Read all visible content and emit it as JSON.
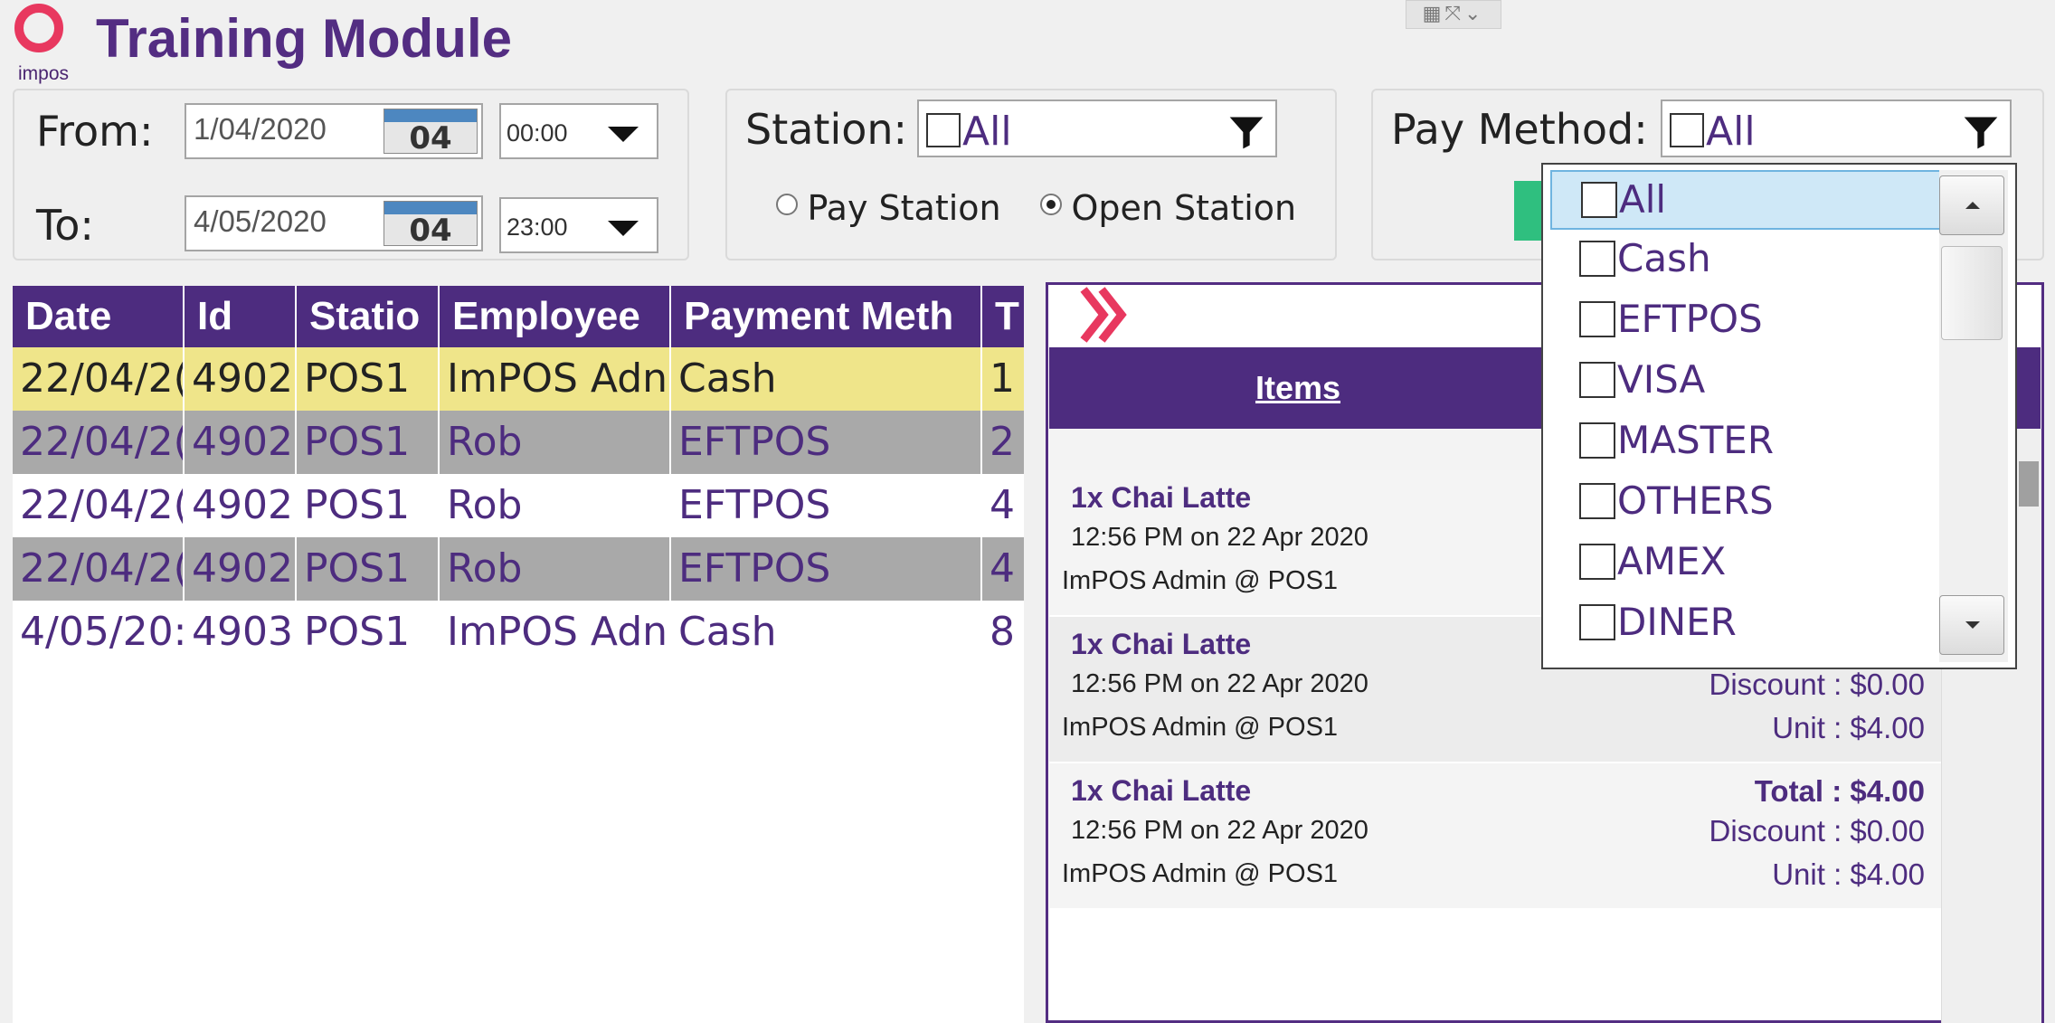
{
  "header": {
    "logo_text": "impos",
    "title": "Training Module"
  },
  "date_filter": {
    "from_label": "From:",
    "from_date": "1/04/2020",
    "from_cal_day": "04",
    "from_time": "00:00",
    "to_label": "To:",
    "to_date": "4/05/2020",
    "to_cal_day": "04",
    "to_time": "23:00"
  },
  "station_filter": {
    "label": "Station:",
    "value": "All",
    "radio_pay": "Pay Station",
    "radio_open": "Open Station",
    "selected": "Open Station"
  },
  "pay_filter": {
    "label": "Pay Method:",
    "value": "All",
    "options": [
      "All",
      "Cash",
      "EFTPOS",
      "VISA",
      "MASTER",
      "OTHERS",
      "AMEX",
      "DINER"
    ],
    "highlighted": "All"
  },
  "grid": {
    "headers": [
      "Date",
      "Id",
      "Statio",
      "Employee",
      "Payment Meth",
      "T"
    ],
    "rows": [
      [
        "22/04/2(",
        "4902!",
        "POS1",
        "ImPOS Adn",
        "Cash",
        "1"
      ],
      [
        "22/04/2(",
        "4902!",
        "POS1",
        "Rob",
        "EFTPOS",
        "2"
      ],
      [
        "22/04/2(",
        "4902!",
        "POS1",
        "Rob",
        "EFTPOS",
        "4"
      ],
      [
        "22/04/2(",
        "4902!",
        "POS1",
        "Rob",
        "EFTPOS",
        "4"
      ],
      [
        "4/05/20:",
        "4903(",
        "POS1",
        "ImPOS Adn",
        "Cash",
        "8"
      ]
    ],
    "row_colors": [
      "#efe58a",
      "#a9a9a9",
      "#ffffff",
      "#a9a9a9",
      "#ffffff"
    ]
  },
  "detail": {
    "items_title": "Items",
    "cards": [
      {
        "name": "1x Chai Latte",
        "time": "12:56 PM on 22 Apr 2020",
        "who": "ImPOS Admin @ POS1",
        "total": "",
        "discount": "",
        "unit": ""
      },
      {
        "name": "1x Chai Latte",
        "time": "12:56 PM on 22 Apr 2020",
        "who": "ImPOS Admin @ POS1",
        "total": "",
        "discount": "Discount : $0.00",
        "unit": "Unit : $4.00"
      },
      {
        "name": "1x Chai Latte",
        "time": "12:56 PM on 22 Apr 2020",
        "who": "ImPOS Admin @ POS1",
        "total": "Total : $4.00",
        "discount": "Discount : $0.00",
        "unit": "Unit : $4.00"
      }
    ]
  },
  "colors": {
    "brand_purple": "#4d2c7f",
    "logo_pink": "#e8385f",
    "row_highlight": "#efe58a",
    "row_alt": "#a9a9a9",
    "accept_green": "#2fbf7f"
  }
}
